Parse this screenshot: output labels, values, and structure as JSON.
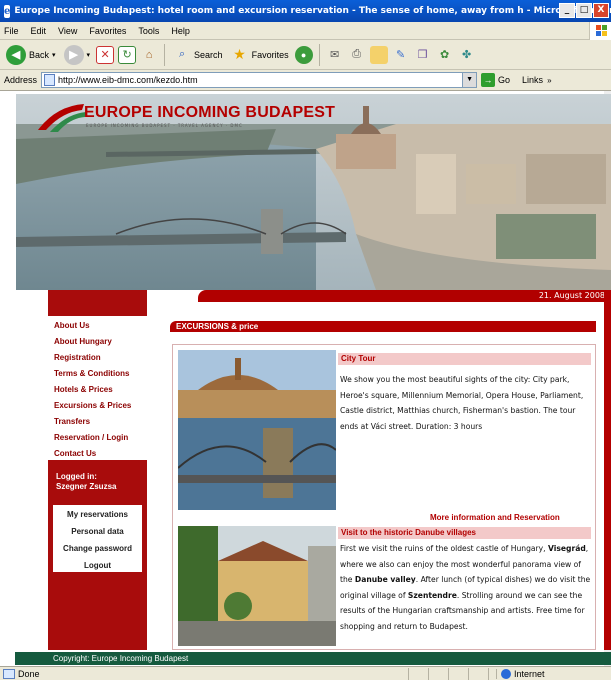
{
  "window": {
    "title": "Europe Incoming Budapest: hotel room and excursion reservation - The sense of home, away from h - Microsoft Internet ...",
    "controls": [
      "_",
      "□",
      "X"
    ]
  },
  "menu": [
    "File",
    "Edit",
    "View",
    "Favorites",
    "Tools",
    "Help"
  ],
  "toolbar": {
    "back": "Back",
    "search": "Search",
    "favorites": "Favorites"
  },
  "address": {
    "label": "Address",
    "url": "http://www.eib-dmc.com/kezdo.htm",
    "go": "Go",
    "links": "Links"
  },
  "site": {
    "logo_title": "EUROPE INCOMING BUDAPEST",
    "logo_sub": "EUROPE INCOMING BUDAPEST · TRAVEL AGENCY · DMC",
    "date": "21. August 2008",
    "nav": [
      "About Us",
      "About Hungary",
      "Registration",
      "Terms & Conditions",
      "Hotels & Prices",
      "Excursions & Prices",
      "Transfers",
      "Reservation / Login",
      "Contact Us"
    ],
    "logged_in_label": "Logged in:",
    "logged_in_user": "Szegner Zsuzsa",
    "user_menu": [
      "My reservations",
      "Personal data",
      "Change password",
      "Logout"
    ],
    "section_header": "EXCURSIONS & price",
    "tours": [
      {
        "title": "City Tour",
        "description": "We show you the most beautiful sights of the city: City park, Heroe's square, Millennium Memorial, Opera House, Parliament, Castle district, Matthias church, Fisherman's bastion. The tour ends at Váci street. Duration: 3 hours"
      },
      {
        "title": "Visit to the historic Danube villages",
        "desc_p1": "First we visit the ruins of the oldest castle of Hungary, ",
        "desc_b1": "Visegrád",
        "desc_p2": ", where we also can enjoy the most wonderful panorama view of the ",
        "desc_b2": "Danube valley",
        "desc_p3": ". After lunch (of typical dishes) we do visit the original village of ",
        "desc_b3": "Szentendre",
        "desc_p4": ". Strolling around we can see the results of the Hungarian craftsmanship and artists. Free time for shopping and return to Budapest."
      }
    ],
    "more_link": "More information and Reservation",
    "footer": "Copyright: Europe Incoming Budapest"
  },
  "status": {
    "left": "Done",
    "zone": "Internet"
  }
}
